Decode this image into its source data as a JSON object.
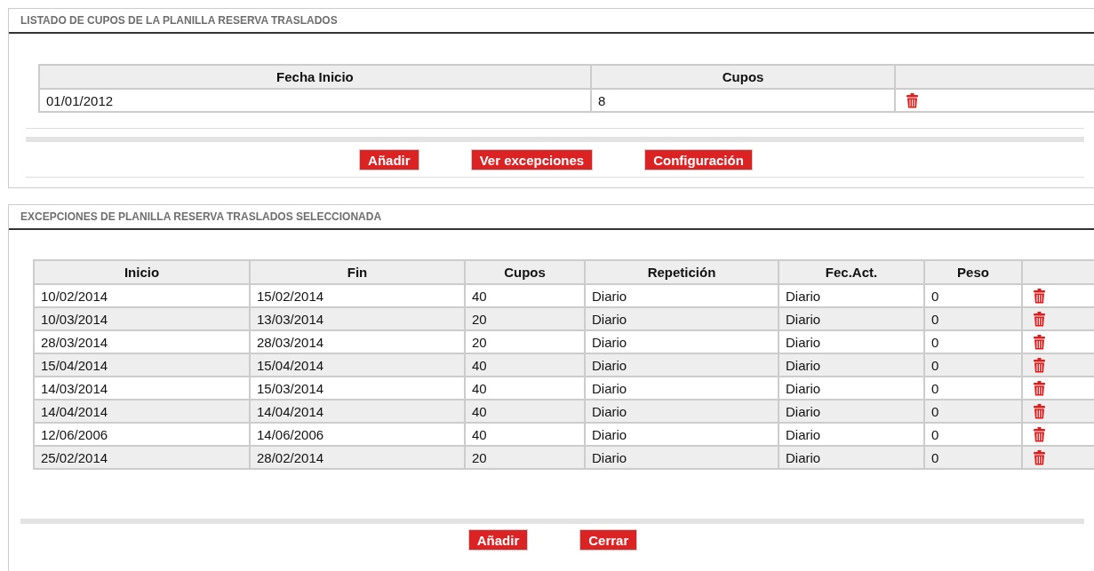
{
  "panels": [
    {
      "title": "LISTADO DE CUPOS DE LA PLANILLA RESERVA TRASLADOS",
      "table": {
        "columns": [
          "Fecha Inicio",
          "Cupos",
          ""
        ],
        "rows": [
          [
            "01/01/2012",
            "8"
          ]
        ]
      },
      "buttons": [
        "Añadir",
        "Ver excepciones",
        "Configuración"
      ]
    },
    {
      "title": "EXCEPCIONES DE PLANILLA RESERVA TRASLADOS SELECCIONADA",
      "table": {
        "columns": [
          "Inicio",
          "Fin",
          "Cupos",
          "Repetición",
          "Fec.Act.",
          "Peso",
          ""
        ],
        "rows": [
          [
            "10/02/2014",
            "15/02/2014",
            "40",
            "Diario",
            "Diario",
            "0"
          ],
          [
            "10/03/2014",
            "13/03/2014",
            "20",
            "Diario",
            "Diario",
            "0"
          ],
          [
            "28/03/2014",
            "28/03/2014",
            "20",
            "Diario",
            "Diario",
            "0"
          ],
          [
            "15/04/2014",
            "15/04/2014",
            "40",
            "Diario",
            "Diario",
            "0"
          ],
          [
            "14/03/2014",
            "15/03/2014",
            "40",
            "Diario",
            "Diario",
            "0"
          ],
          [
            "14/04/2014",
            "14/04/2014",
            "40",
            "Diario",
            "Diario",
            "0"
          ],
          [
            "12/06/2006",
            "14/06/2006",
            "40",
            "Diario",
            "Diario",
            "0"
          ],
          [
            "25/02/2014",
            "28/02/2014",
            "20",
            "Diario",
            "Diario",
            "0"
          ]
        ]
      },
      "buttons": [
        "Añadir",
        "Cerrar"
      ]
    }
  ]
}
